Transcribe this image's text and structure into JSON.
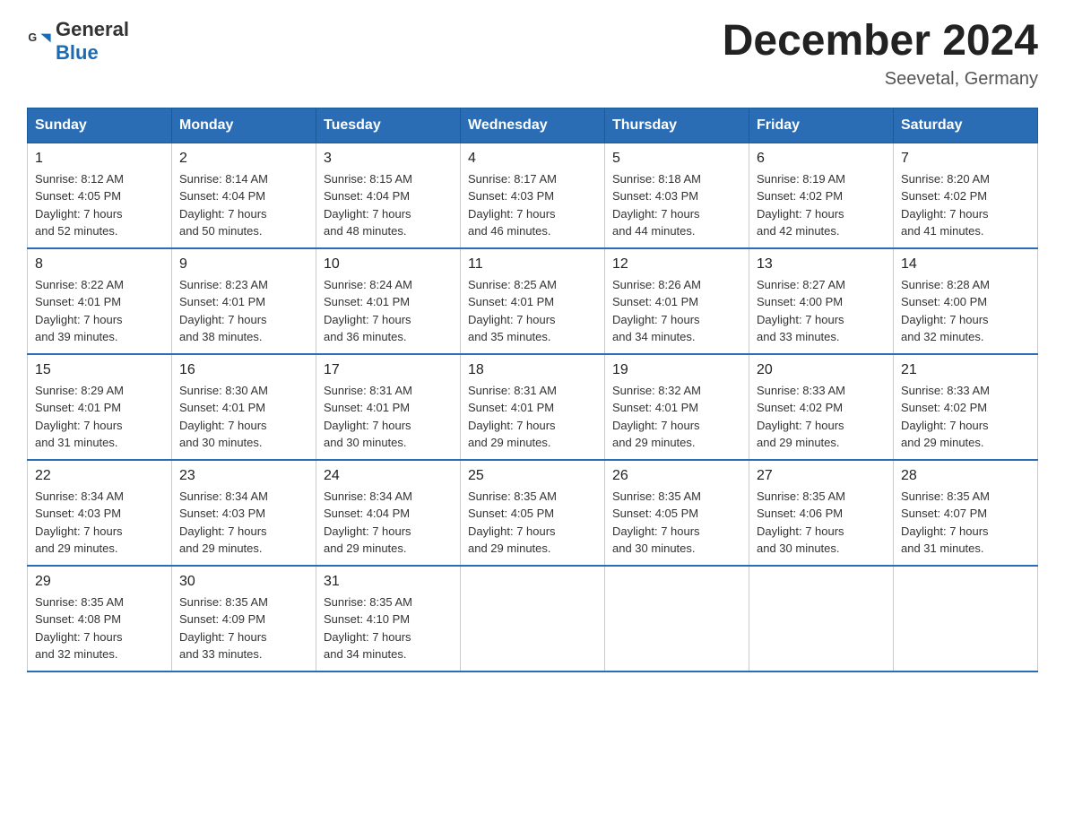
{
  "header": {
    "logo": {
      "general": "General",
      "blue": "Blue"
    },
    "title": "December 2024",
    "location": "Seevetal, Germany"
  },
  "days_of_week": [
    "Sunday",
    "Monday",
    "Tuesday",
    "Wednesday",
    "Thursday",
    "Friday",
    "Saturday"
  ],
  "weeks": [
    [
      {
        "day": "1",
        "sunrise": "8:12 AM",
        "sunset": "4:05 PM",
        "daylight": "7 hours and 52 minutes."
      },
      {
        "day": "2",
        "sunrise": "8:14 AM",
        "sunset": "4:04 PM",
        "daylight": "7 hours and 50 minutes."
      },
      {
        "day": "3",
        "sunrise": "8:15 AM",
        "sunset": "4:04 PM",
        "daylight": "7 hours and 48 minutes."
      },
      {
        "day": "4",
        "sunrise": "8:17 AM",
        "sunset": "4:03 PM",
        "daylight": "7 hours and 46 minutes."
      },
      {
        "day": "5",
        "sunrise": "8:18 AM",
        "sunset": "4:03 PM",
        "daylight": "7 hours and 44 minutes."
      },
      {
        "day": "6",
        "sunrise": "8:19 AM",
        "sunset": "4:02 PM",
        "daylight": "7 hours and 42 minutes."
      },
      {
        "day": "7",
        "sunrise": "8:20 AM",
        "sunset": "4:02 PM",
        "daylight": "7 hours and 41 minutes."
      }
    ],
    [
      {
        "day": "8",
        "sunrise": "8:22 AM",
        "sunset": "4:01 PM",
        "daylight": "7 hours and 39 minutes."
      },
      {
        "day": "9",
        "sunrise": "8:23 AM",
        "sunset": "4:01 PM",
        "daylight": "7 hours and 38 minutes."
      },
      {
        "day": "10",
        "sunrise": "8:24 AM",
        "sunset": "4:01 PM",
        "daylight": "7 hours and 36 minutes."
      },
      {
        "day": "11",
        "sunrise": "8:25 AM",
        "sunset": "4:01 PM",
        "daylight": "7 hours and 35 minutes."
      },
      {
        "day": "12",
        "sunrise": "8:26 AM",
        "sunset": "4:01 PM",
        "daylight": "7 hours and 34 minutes."
      },
      {
        "day": "13",
        "sunrise": "8:27 AM",
        "sunset": "4:00 PM",
        "daylight": "7 hours and 33 minutes."
      },
      {
        "day": "14",
        "sunrise": "8:28 AM",
        "sunset": "4:00 PM",
        "daylight": "7 hours and 32 minutes."
      }
    ],
    [
      {
        "day": "15",
        "sunrise": "8:29 AM",
        "sunset": "4:01 PM",
        "daylight": "7 hours and 31 minutes."
      },
      {
        "day": "16",
        "sunrise": "8:30 AM",
        "sunset": "4:01 PM",
        "daylight": "7 hours and 30 minutes."
      },
      {
        "day": "17",
        "sunrise": "8:31 AM",
        "sunset": "4:01 PM",
        "daylight": "7 hours and 30 minutes."
      },
      {
        "day": "18",
        "sunrise": "8:31 AM",
        "sunset": "4:01 PM",
        "daylight": "7 hours and 29 minutes."
      },
      {
        "day": "19",
        "sunrise": "8:32 AM",
        "sunset": "4:01 PM",
        "daylight": "7 hours and 29 minutes."
      },
      {
        "day": "20",
        "sunrise": "8:33 AM",
        "sunset": "4:02 PM",
        "daylight": "7 hours and 29 minutes."
      },
      {
        "day": "21",
        "sunrise": "8:33 AM",
        "sunset": "4:02 PM",
        "daylight": "7 hours and 29 minutes."
      }
    ],
    [
      {
        "day": "22",
        "sunrise": "8:34 AM",
        "sunset": "4:03 PM",
        "daylight": "7 hours and 29 minutes."
      },
      {
        "day": "23",
        "sunrise": "8:34 AM",
        "sunset": "4:03 PM",
        "daylight": "7 hours and 29 minutes."
      },
      {
        "day": "24",
        "sunrise": "8:34 AM",
        "sunset": "4:04 PM",
        "daylight": "7 hours and 29 minutes."
      },
      {
        "day": "25",
        "sunrise": "8:35 AM",
        "sunset": "4:05 PM",
        "daylight": "7 hours and 29 minutes."
      },
      {
        "day": "26",
        "sunrise": "8:35 AM",
        "sunset": "4:05 PM",
        "daylight": "7 hours and 30 minutes."
      },
      {
        "day": "27",
        "sunrise": "8:35 AM",
        "sunset": "4:06 PM",
        "daylight": "7 hours and 30 minutes."
      },
      {
        "day": "28",
        "sunrise": "8:35 AM",
        "sunset": "4:07 PM",
        "daylight": "7 hours and 31 minutes."
      }
    ],
    [
      {
        "day": "29",
        "sunrise": "8:35 AM",
        "sunset": "4:08 PM",
        "daylight": "7 hours and 32 minutes."
      },
      {
        "day": "30",
        "sunrise": "8:35 AM",
        "sunset": "4:09 PM",
        "daylight": "7 hours and 33 minutes."
      },
      {
        "day": "31",
        "sunrise": "8:35 AM",
        "sunset": "4:10 PM",
        "daylight": "7 hours and 34 minutes."
      },
      null,
      null,
      null,
      null
    ]
  ]
}
